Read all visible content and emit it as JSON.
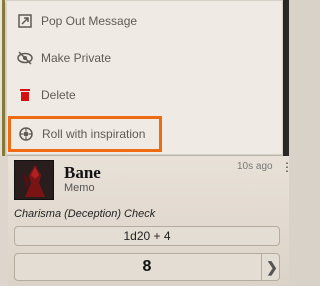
{
  "menu": {
    "items": [
      {
        "label": "Pop Out Message",
        "icon": "pop-out-icon"
      },
      {
        "label": "Make Private",
        "icon": "eye-slash-icon"
      },
      {
        "label": "Delete",
        "icon": "trash-icon"
      },
      {
        "label": "Roll with inspiration",
        "icon": "inspiration-icon"
      }
    ]
  },
  "message": {
    "speaker": "Bane",
    "subtitle": "Memo",
    "timestamp": "10s ago",
    "flavor": "Charisma (Deception) Check",
    "formula": "1d20 + 4",
    "total": "8"
  },
  "colors": {
    "highlight": "#ee6b14",
    "delete_icon": "#d61010"
  }
}
